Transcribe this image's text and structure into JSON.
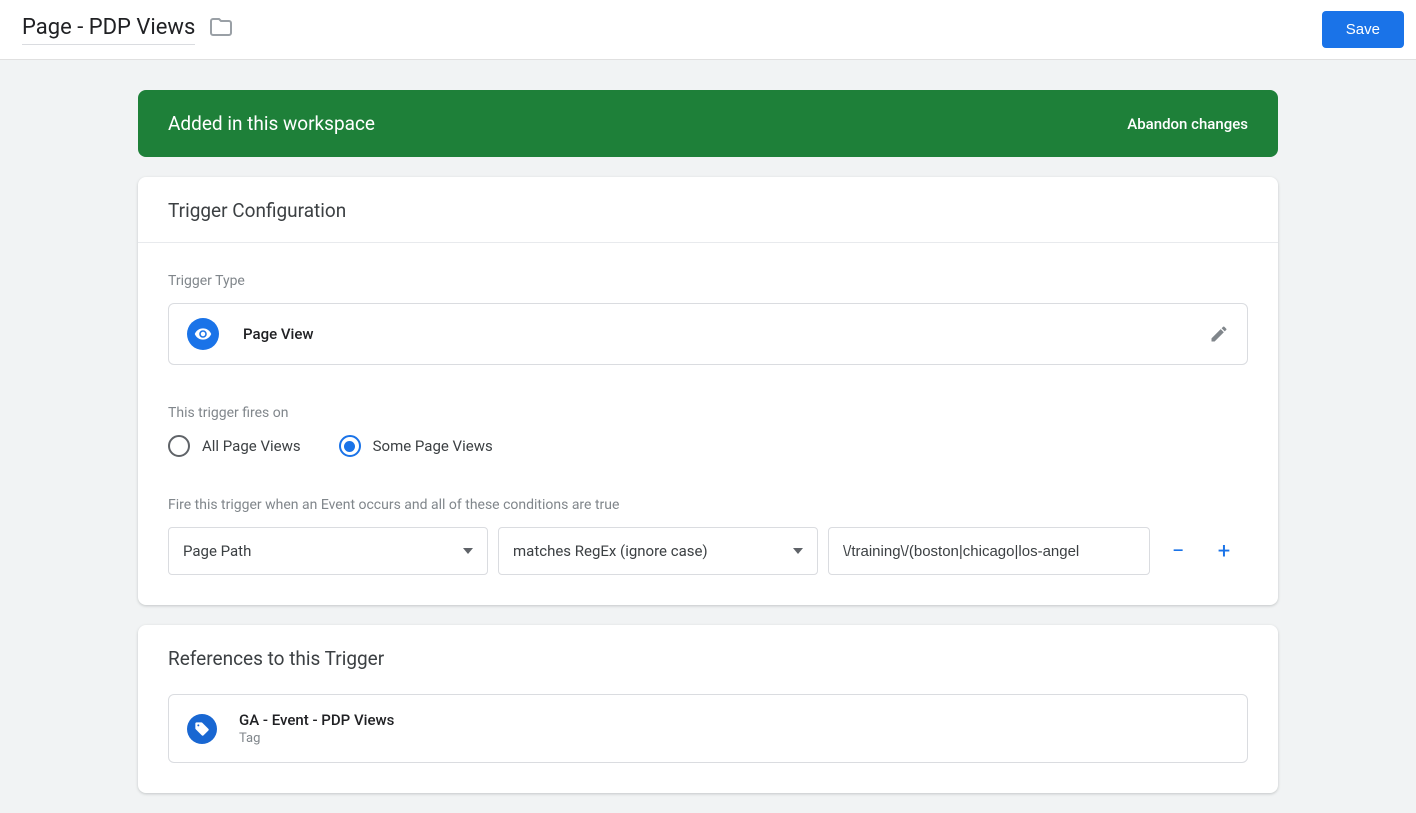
{
  "header": {
    "title": "Page - PDP Views",
    "save_label": "Save"
  },
  "banner": {
    "title": "Added in this workspace",
    "action": "Abandon changes"
  },
  "trigger": {
    "section_title": "Trigger Configuration",
    "type_label": "Trigger Type",
    "type_name": "Page View",
    "fires_on_label": "This trigger fires on",
    "radio_all": "All Page Views",
    "radio_some": "Some Page Views",
    "condition_intro": "Fire this trigger when an Event occurs and all of these conditions are true",
    "condition": {
      "variable": "Page Path",
      "operator": "matches RegEx (ignore case)",
      "value": "\\/training\\/(boston|chicago|los-angel"
    }
  },
  "references": {
    "title": "References to this Trigger",
    "items": [
      {
        "name": "GA - Event - PDP Views",
        "type": "Tag"
      }
    ]
  }
}
